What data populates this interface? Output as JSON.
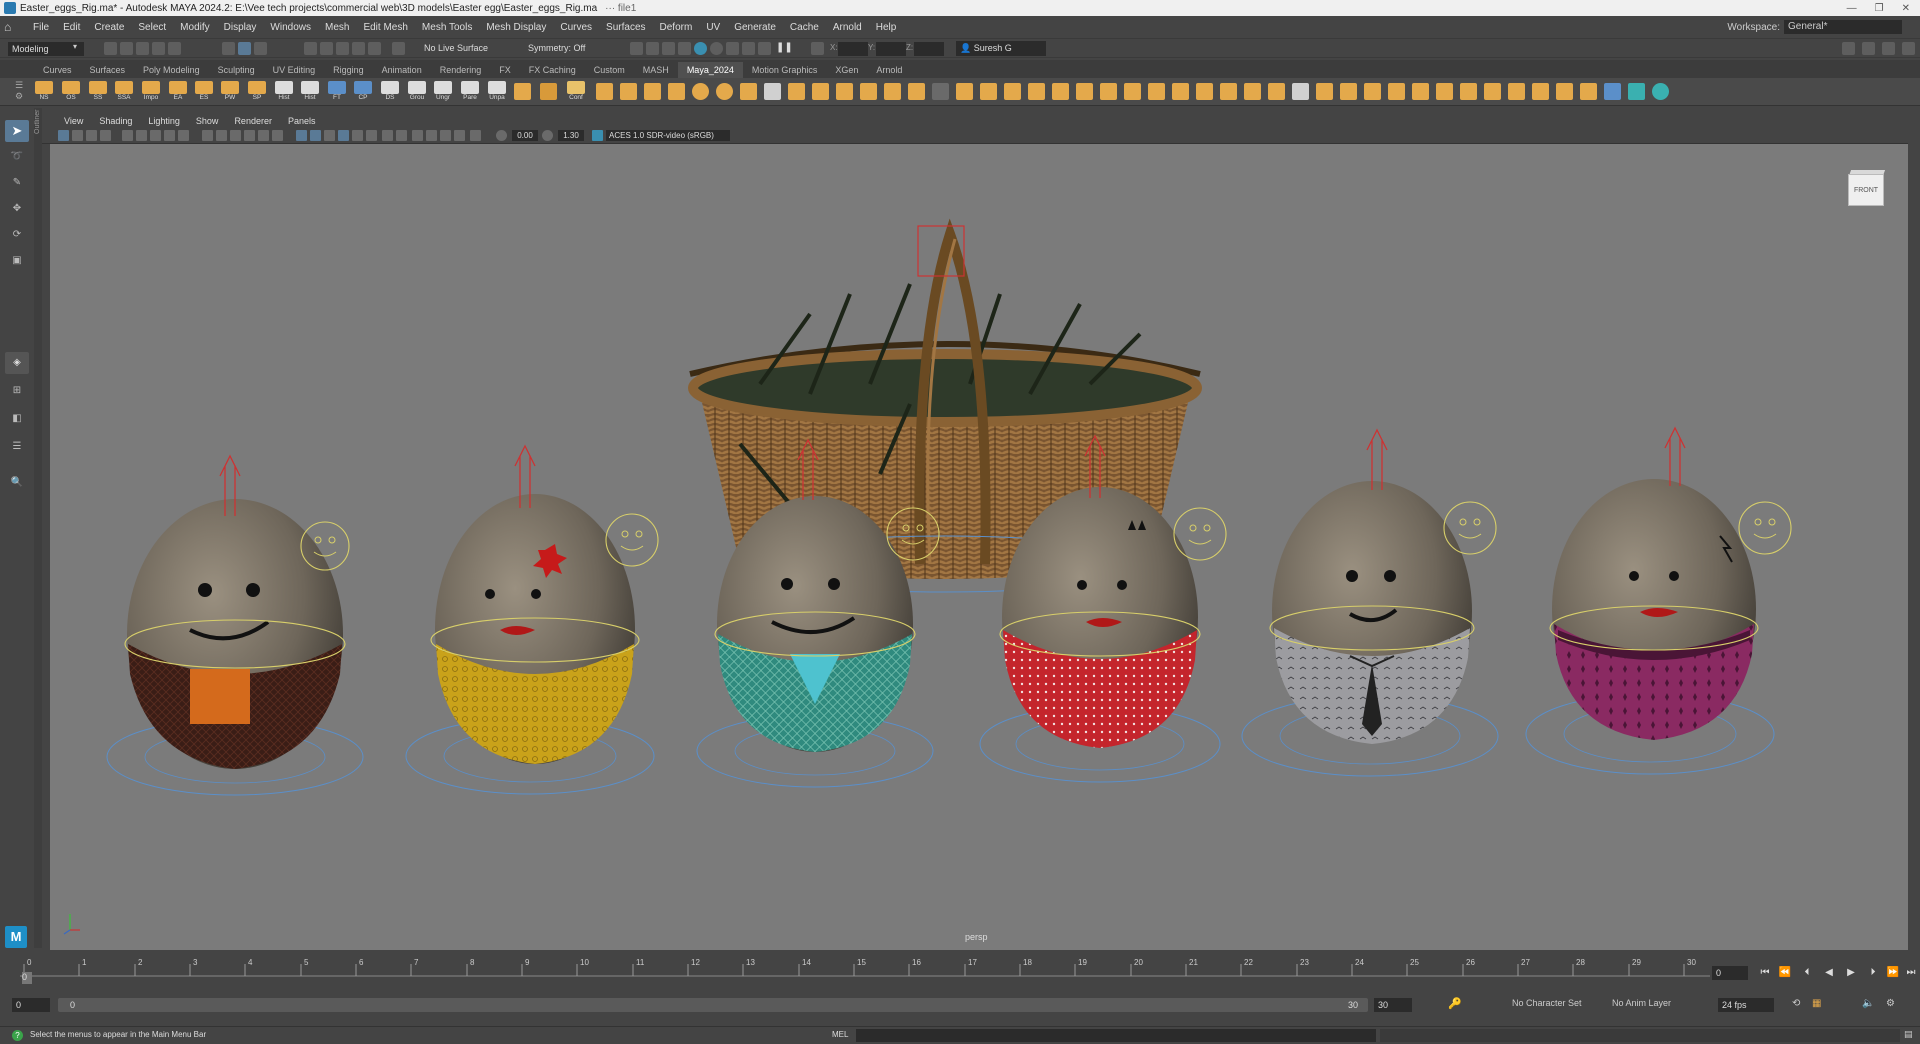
{
  "window": {
    "title": "Easter_eggs_Rig.ma* - Autodesk MAYA 2024.2: E:\\Vee tech projects\\commercial web\\3D models\\Easter egg\\Easter_eggs_Rig.ma",
    "extra": "···  file1"
  },
  "menus": [
    "File",
    "Edit",
    "Create",
    "Select",
    "Modify",
    "Display",
    "Windows",
    "Mesh",
    "Edit Mesh",
    "Mesh Tools",
    "Mesh Display",
    "Curves",
    "Surfaces",
    "Deform",
    "UV",
    "Generate",
    "Cache",
    "Arnold",
    "Help"
  ],
  "workspace": {
    "label": "Workspace:",
    "value": "General*"
  },
  "statusline": {
    "mode": "Modeling",
    "live_surface": "No Live Surface",
    "symmetry": "Symmetry: Off",
    "x_label": "X:",
    "y_label": "Y:",
    "z_label": "Z:",
    "user": "Suresh G"
  },
  "shelf_tabs": [
    "Curves",
    "Surfaces",
    "Poly Modeling",
    "Sculpting",
    "UV Editing",
    "Rigging",
    "Animation",
    "Rendering",
    "FX",
    "FX Caching",
    "Custom",
    "MASH",
    "Maya_2024",
    "Motion Graphics",
    "XGen",
    "Arnold"
  ],
  "shelf_active": "Maya_2024",
  "shelf_buttons": [
    "NS",
    "OS",
    "SS",
    "SSA",
    "Impo",
    "EA",
    "ES",
    "PW",
    "SP",
    "Hist",
    "Hist",
    "FT",
    "CP",
    "DS",
    "Grou",
    "Ungr",
    "Pare",
    "Unpa"
  ],
  "shelf_end_label": "Conf",
  "panel_menus": [
    "View",
    "Shading",
    "Lighting",
    "Show",
    "Renderer",
    "Panels"
  ],
  "panel_toolbar": {
    "exposure": "0.00",
    "gamma": "1.30",
    "colorspace": "ACES 1.0 SDR-video (sRGB)"
  },
  "outliner_label": "Outliner",
  "viewport": {
    "camera": "persp",
    "viewcube": "FRONT"
  },
  "timeline": {
    "ticks": [
      "0",
      "1",
      "2",
      "3",
      "4",
      "5",
      "6",
      "7",
      "8",
      "9",
      "10",
      "11",
      "12",
      "13",
      "14",
      "15",
      "16",
      "17",
      "18",
      "19",
      "20",
      "21",
      "22",
      "23",
      "24",
      "25",
      "26",
      "27",
      "28",
      "29",
      "30"
    ],
    "current_frame": "0",
    "current_marker": "0",
    "current_frame_field": "0"
  },
  "range": {
    "start": "0",
    "playback_start": "0",
    "playback_end": "30",
    "end": "30",
    "character_set": "No Character Set",
    "anim_layer": "No Anim Layer",
    "fps": "24 fps"
  },
  "helpline": {
    "message": "Select the menus to appear in the Main Menu Bar",
    "lang": "MEL"
  },
  "logo_letter": "M",
  "colors": {
    "accent": "#5a7a96",
    "viewport_bg": "#7b7b7b",
    "shelf_icon": "#e4a94b",
    "rig_yellow": "#d8cf6a",
    "rig_red": "#cc3333",
    "rig_blue": "#5b8fc9"
  }
}
